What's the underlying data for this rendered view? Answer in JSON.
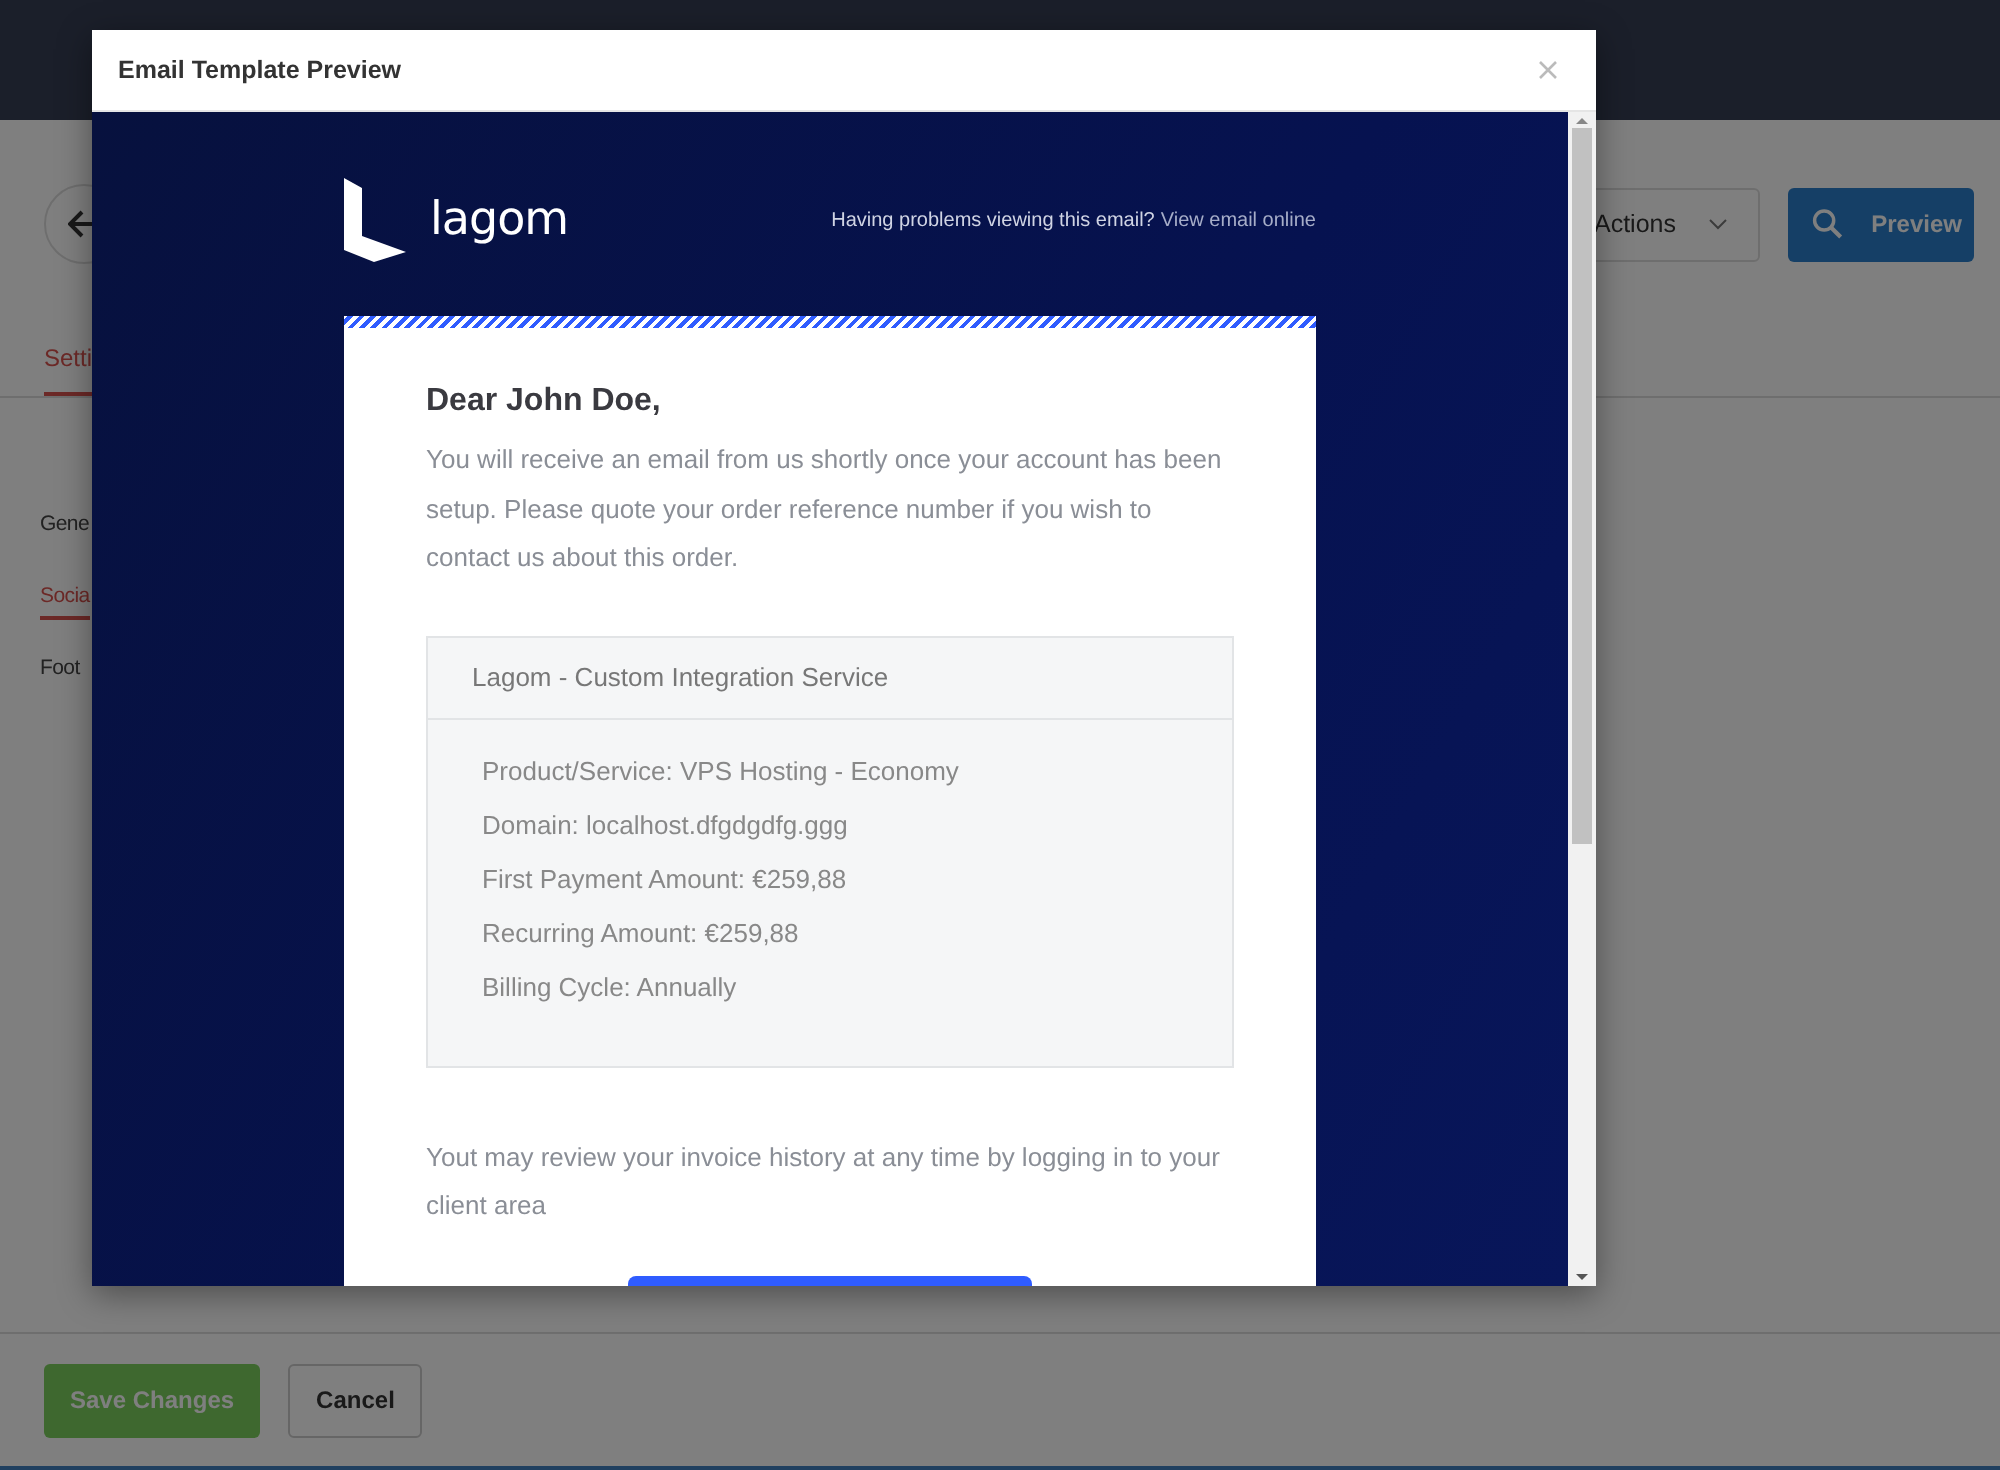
{
  "page": {
    "tabs": [
      {
        "label": "Setti",
        "selected": true
      }
    ],
    "sidebar": [
      {
        "label": "Gene",
        "selected": false
      },
      {
        "label": "Socia",
        "selected": true
      },
      {
        "label": "Foot",
        "selected": false
      }
    ],
    "actions_button": "Actions",
    "preview_button": "Preview",
    "footer_buttons": [
      {
        "label": "Save Changes",
        "kind": "primary"
      },
      {
        "label": "Cancel",
        "kind": "secondary"
      }
    ]
  },
  "modal": {
    "title": "Email Template Preview",
    "email": {
      "logo_text": "lagom",
      "top_note": "Having problems viewing this email?",
      "top_link": "View email online",
      "greeting": "Dear John Doe,",
      "intro": "You will receive an email from us shortly once your account has been setup. Please quote your order reference number if you wish to contact us about this order.",
      "order_box": {
        "title": "Lagom - Custom Integration Service",
        "lines": [
          "Product/Service: VPS Hosting - Economy",
          "Domain: localhost.dfgdgdfg.ggg",
          "First Payment Amount: €259,88",
          "Recurring Amount: €259,88",
          "Billing Cycle: Annually"
        ]
      },
      "outro": "Yout may review your invoice history at any time by logging in to your client area"
    }
  }
}
